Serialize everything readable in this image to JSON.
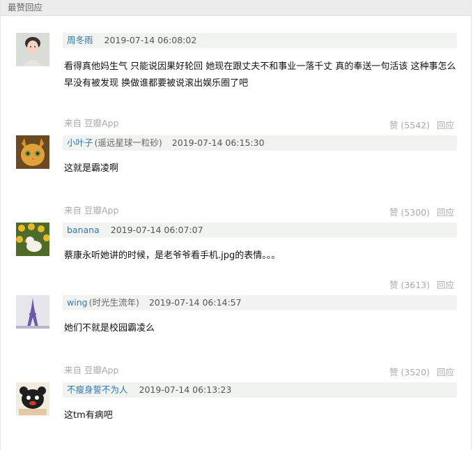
{
  "section": {
    "title": "最赞回应"
  },
  "comments": [
    {
      "author": "周冬雨",
      "author_note": "",
      "time": "2019-07-14 06:08:02",
      "text": "看得真他妈生气 只能说因果好轮回 她现在跟丈夫不和事业一落千丈 真的奉送一句活该 这种事怎么早没有被发现 换做谁都要被说滚出娱乐圈了吧",
      "source": "来自 豆瓣App",
      "likes": "赞 (5542)",
      "reply": "回应",
      "avatar_icon": "portrait-woman-avatar"
    },
    {
      "author": "小叶子",
      "author_note": "(遥远星球一粒砂)",
      "time": "2019-07-14 06:15:30",
      "text": "这就是霸凌啊",
      "source": "来自 豆瓣App",
      "likes": "赞 (5300)",
      "reply": "回应",
      "avatar_icon": "cat-avatar"
    },
    {
      "author": "banana",
      "author_note": "",
      "time": "2019-07-14 06:07:07",
      "text": "蔡康永听她讲的时候，是老爷爷看手机.jpg的表情。。。",
      "source": "",
      "likes": "赞 (3613)",
      "reply": "回应",
      "avatar_icon": "duck-sunflower-avatar"
    },
    {
      "author": "wing",
      "author_note": "(时光生流年)",
      "time": "2019-07-14 06:14:57",
      "text": "她们不就是校园霸凌么",
      "source": "来自 豆瓣App",
      "likes": "赞 (3520)",
      "reply": "回应",
      "avatar_icon": "eiffel-tower-avatar"
    },
    {
      "author": "不瘦身誓不为人",
      "author_note": "",
      "time": "2019-07-14 06:13:23",
      "text": "这tm有病吧",
      "source": "",
      "likes": "",
      "reply": "",
      "avatar_icon": "bear-avatar"
    }
  ],
  "colors": {
    "link": "#3377aa",
    "meta_bg": "#f0f3f0",
    "muted": "#aaaaaa"
  }
}
